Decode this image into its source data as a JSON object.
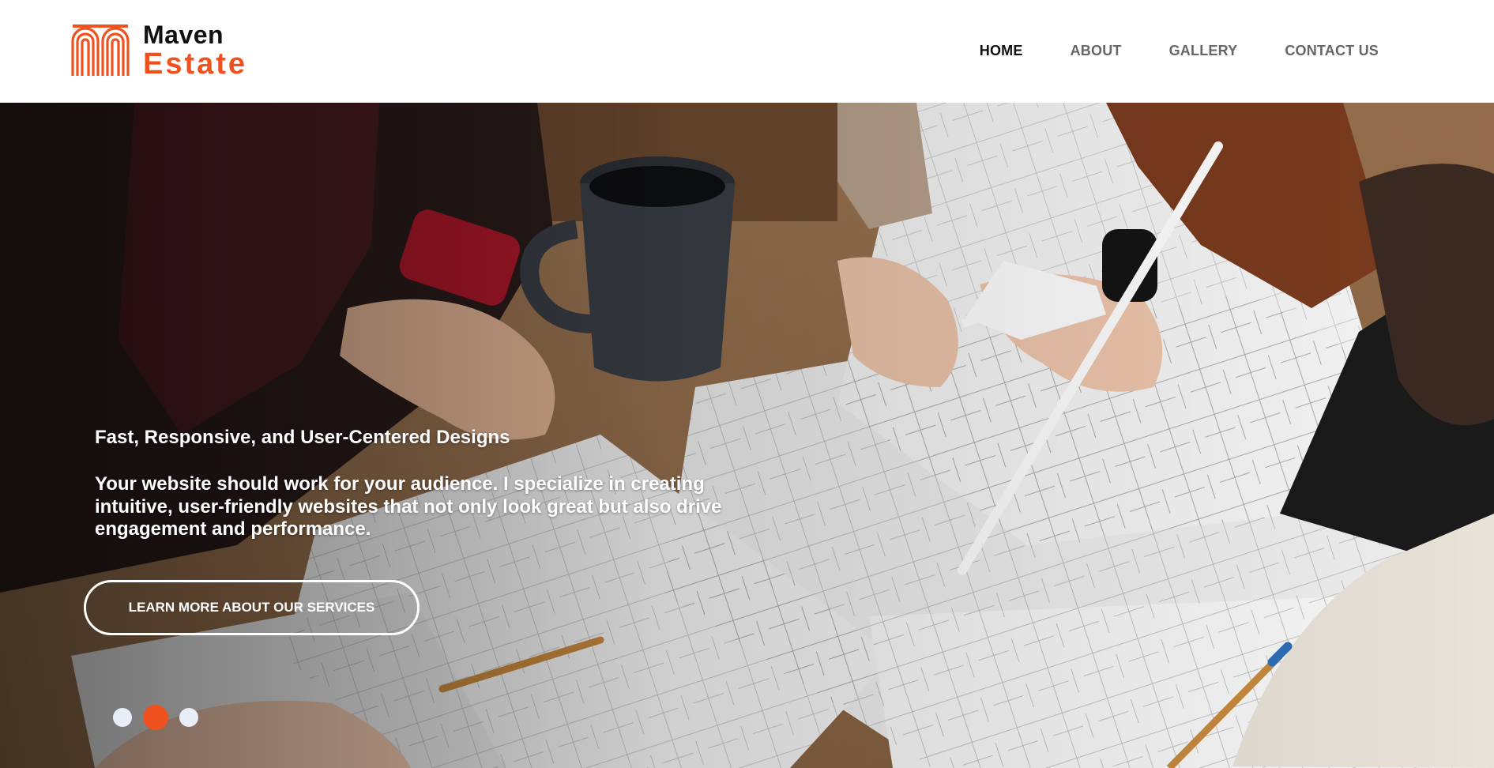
{
  "brand": {
    "line1": "Maven",
    "line2": "Estate",
    "accent_color": "#f0521f"
  },
  "nav": {
    "items": [
      {
        "label": "HOME",
        "active": true
      },
      {
        "label": "ABOUT",
        "active": false
      },
      {
        "label": "GALLERY",
        "active": false
      },
      {
        "label": "CONTACT US",
        "active": false
      }
    ]
  },
  "hero": {
    "title": "Fast, Responsive, and User-Centered Designs",
    "body": "Your website should work for your audience. I specialize in creating intuitive, user-friendly websites that not only look great but also drive engagement and performance.",
    "cta_label": "LEARN MORE ABOUT OUR SERVICES",
    "background": "photo of people working over architectural blueprints with a coffee mug",
    "carousel": {
      "slide_count": 3,
      "active_index": 2
    }
  }
}
